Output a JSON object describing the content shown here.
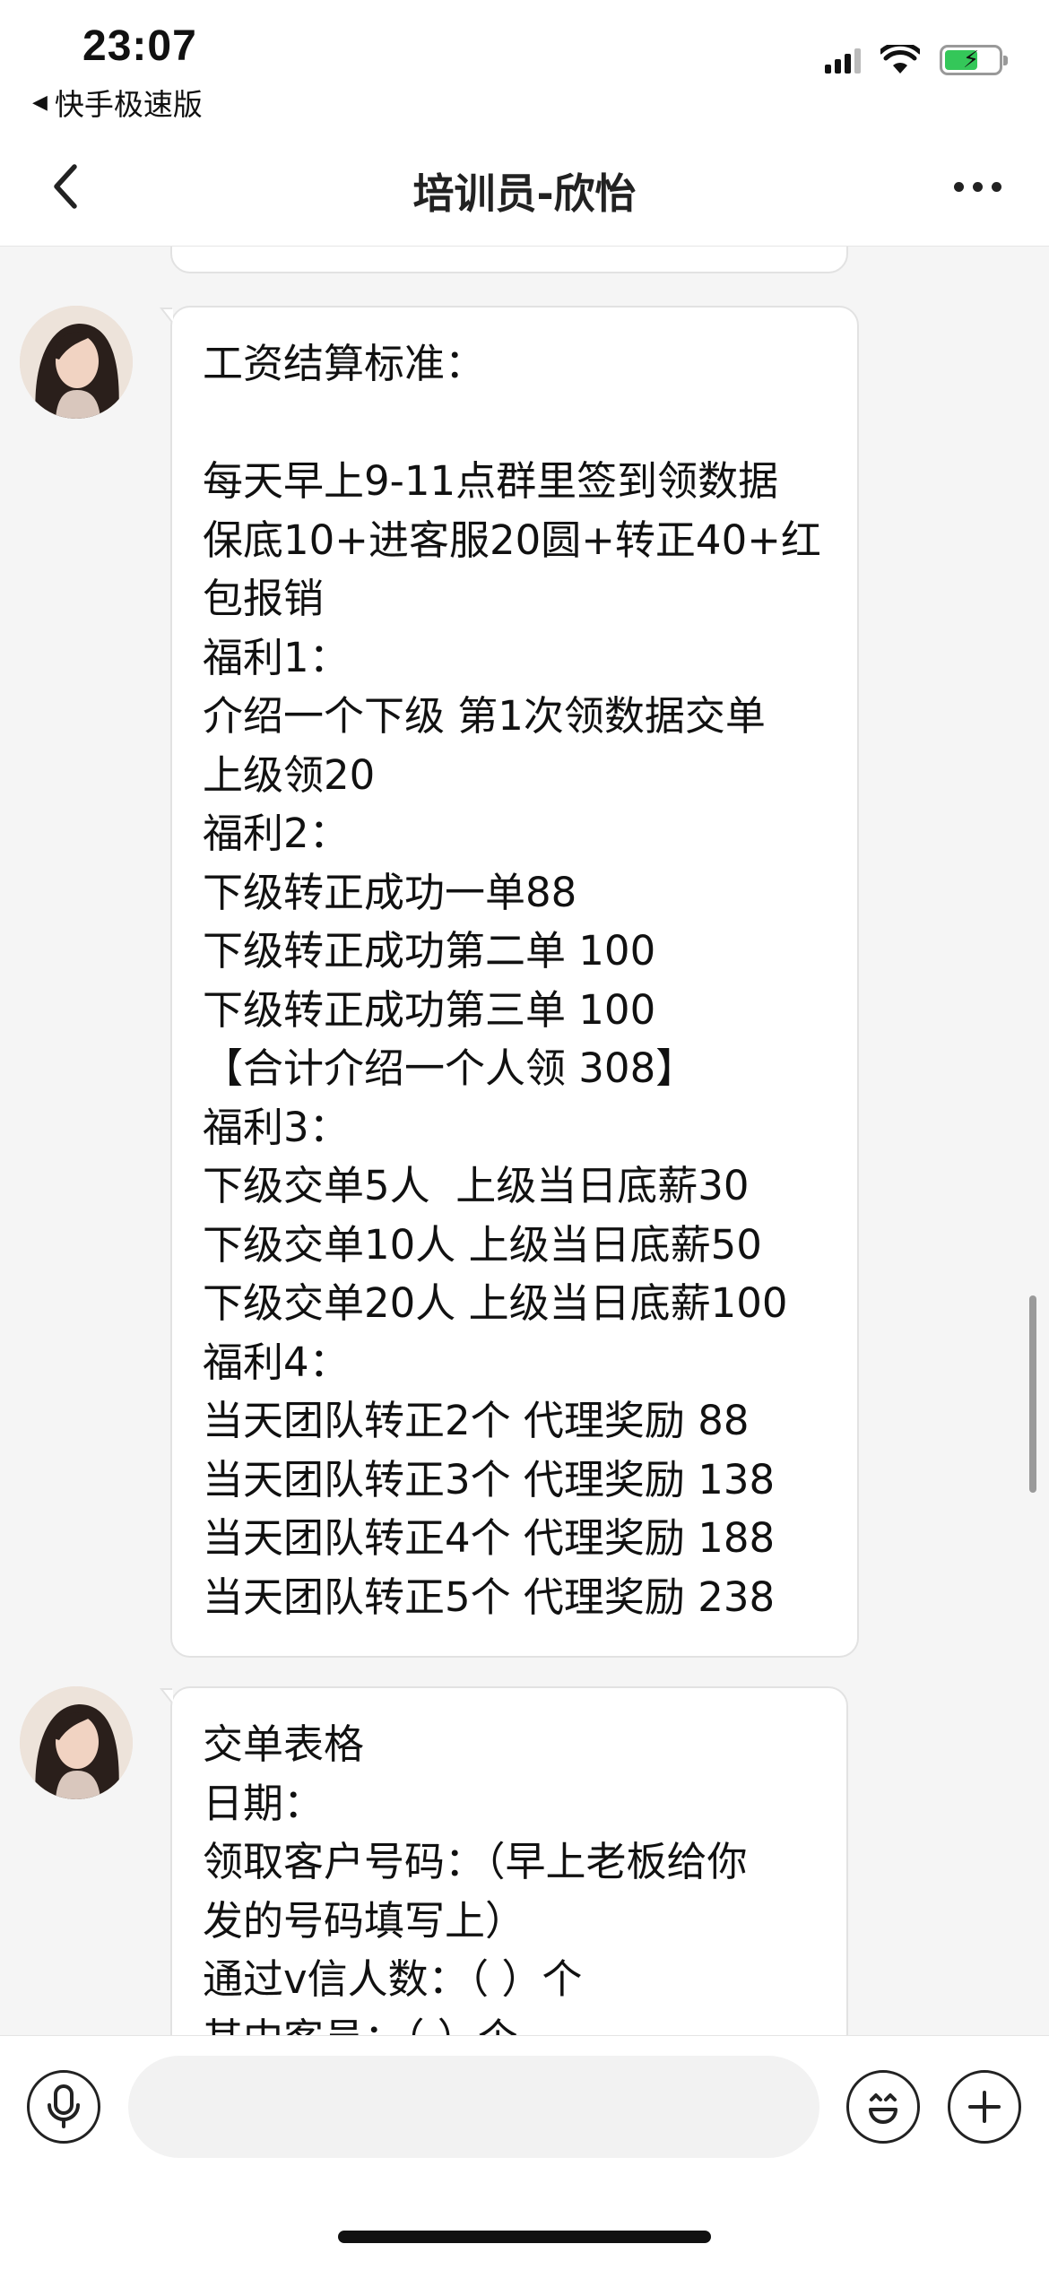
{
  "status_bar": {
    "time": "23:07",
    "back_app": "快手极速版",
    "icons": [
      "cellular-signal-icon",
      "wifi-icon",
      "battery-charging-icon"
    ]
  },
  "nav": {
    "title": "培训员-欣怡",
    "back_icon": "chevron-left-icon",
    "more_icon": "more-dots-icon"
  },
  "messages": [
    {
      "sender": "培训员-欣怡",
      "lines": [
        "工资结算标准：",
        "",
        "每天早上9-11点群里签到领数据",
        "保底10+进客服20圆+转正40+红",
        "包报销",
        "福利1：",
        "介绍一个下级 第1次领数据交单",
        "上级领20",
        "福利2：",
        "下级转正成功一单88",
        "下级转正成功第二单 100",
        "下级转正成功第三单 100",
        "【合计介绍一个人领 308】",
        "福利3：",
        "下级交单5人  上级当日底薪30",
        "下级交单10人 上级当日底薪50",
        "下级交单20人 上级当日底薪100",
        "福利4：",
        "当天团队转正2个 代理奖励 88",
        "当天团队转正3个 代理奖励 138",
        "当天团队转正4个 代理奖励 188",
        "当天团队转正5个 代理奖励 238"
      ]
    },
    {
      "sender": "培训员-欣怡",
      "lines": [
        "交单表格",
        "日期：",
        "领取客户号码：（早上老板给你",
        "发的号码填写上）",
        "通过v信人数：（ ）个",
        "其中客员：（ ）个"
      ]
    }
  ],
  "input_bar": {
    "voice_icon": "microphone-icon",
    "text_value": "",
    "emoji_icon": "emoji-icon",
    "plus_icon": "plus-icon"
  },
  "colors": {
    "background": "#f5f5f5",
    "bubble": "#ffffff",
    "bubble_border": "#e2e2e2",
    "text": "#111111",
    "battery": "#34c759"
  }
}
